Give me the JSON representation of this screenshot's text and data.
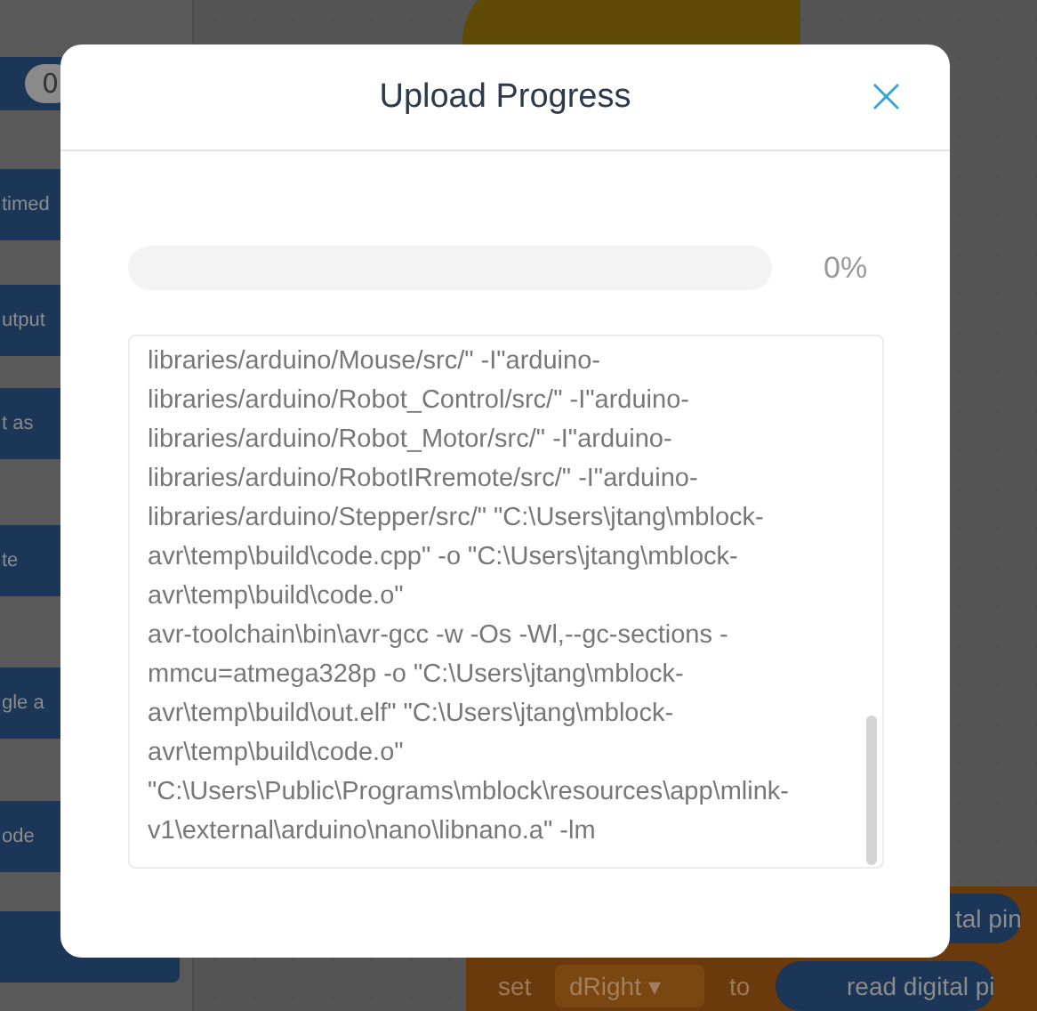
{
  "background": {
    "palette_blocks": [
      {
        "text": "0",
        "kind": "pill"
      },
      {
        "text": "timed",
        "kind": "block"
      },
      {
        "text": "utput",
        "kind": "block"
      },
      {
        "text": "t as",
        "kind": "block"
      },
      {
        "text": "te",
        "kind": "block"
      },
      {
        "text": "gle a",
        "kind": "block"
      },
      {
        "text": "ode",
        "kind": "block"
      }
    ],
    "canvas_blocks": {
      "pin_block": "tal pin",
      "set_label": "set",
      "variable": "dRight ▾",
      "to_label": "to",
      "read_block": "read digital pi"
    }
  },
  "dialog": {
    "title": "Upload Progress",
    "close": "×",
    "progress": {
      "level": 0,
      "reading": "0%"
    },
    "log_lines": [
      "libraries/arduino/Mouse/src/\" -I\"arduino-",
      "libraries/arduino/Robot_Control/src/\" -I\"arduino-",
      "libraries/arduino/Robot_Motor/src/\" -I\"arduino-",
      "libraries/arduino/RobotIRremote/src/\" -I\"arduino-",
      "libraries/arduino/Stepper/src/\" \"C:\\Users\\jtang\\mblock-",
      "avr\\temp\\build\\code.cpp\" -o \"C:\\Users\\jtang\\mblock-",
      "avr\\temp\\build\\code.o\"",
      "avr-toolchain\\bin\\avr-gcc -w -Os -Wl,--gc-sections -",
      "mmcu=atmega328p -o \"C:\\Users\\jtang\\mblock-",
      "avr\\temp\\build\\out.elf\" \"C:\\Users\\jtang\\mblock-",
      "avr\\temp\\build\\code.o\"",
      "\"C:\\Users\\Public\\Programs\\mblock\\resources\\app\\mlink-",
      "v1\\external\\arduino\\nano\\libnano.a\" -lm"
    ]
  }
}
